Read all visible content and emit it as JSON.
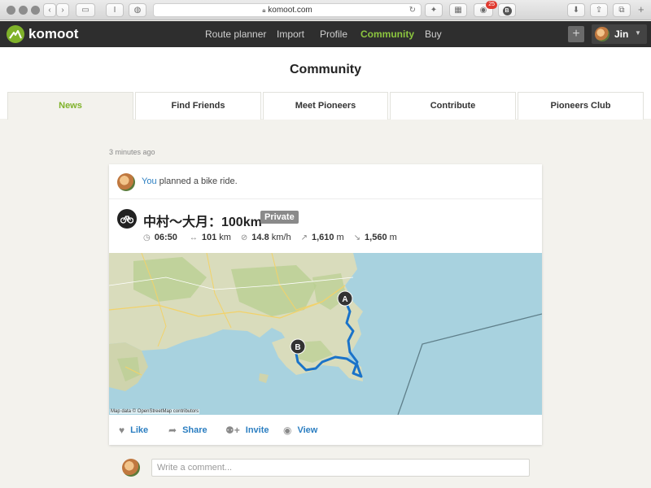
{
  "browser": {
    "url": "komoot.com",
    "notification_count": "25",
    "ext_letter": "B",
    "reader_label": "I"
  },
  "nav": {
    "logo_text": "komoot",
    "links": [
      "Route planner",
      "Import",
      "Profile",
      "Community",
      "Buy"
    ],
    "active": "Community",
    "plus_label": "+",
    "user_name": "Jin"
  },
  "page": {
    "title": "Community",
    "tabs": [
      "News",
      "Find Friends",
      "Meet Pioneers",
      "Contribute",
      "Pioneers Club"
    ],
    "active_tab": "News"
  },
  "feed": {
    "timestamp": "3 minutes ago",
    "actor": "You",
    "action_text": " planned a bike ride.",
    "tour": {
      "title": "中村〜大月：100km",
      "visibility": "Private",
      "duration": "06:50",
      "distance_value": "101",
      "distance_unit": "km",
      "speed_value": "14.8",
      "speed_unit": "km/h",
      "uphill_value": "1,610",
      "uphill_unit": "m",
      "downhill_value": "1,560",
      "downhill_unit": "m"
    },
    "map": {
      "marker_start": "A",
      "marker_end": "B",
      "attribution": "Map data © OpenStreetMap contributors"
    },
    "actions": {
      "like": "Like",
      "share": "Share",
      "invite": "Invite",
      "view": "View"
    },
    "comment_placeholder": "Write a comment..."
  },
  "colors": {
    "brand_green": "#7fb22a",
    "link_blue": "#2b7ec1",
    "nav_bg": "#2e2e2e",
    "route_blue": "#1a73c9"
  }
}
